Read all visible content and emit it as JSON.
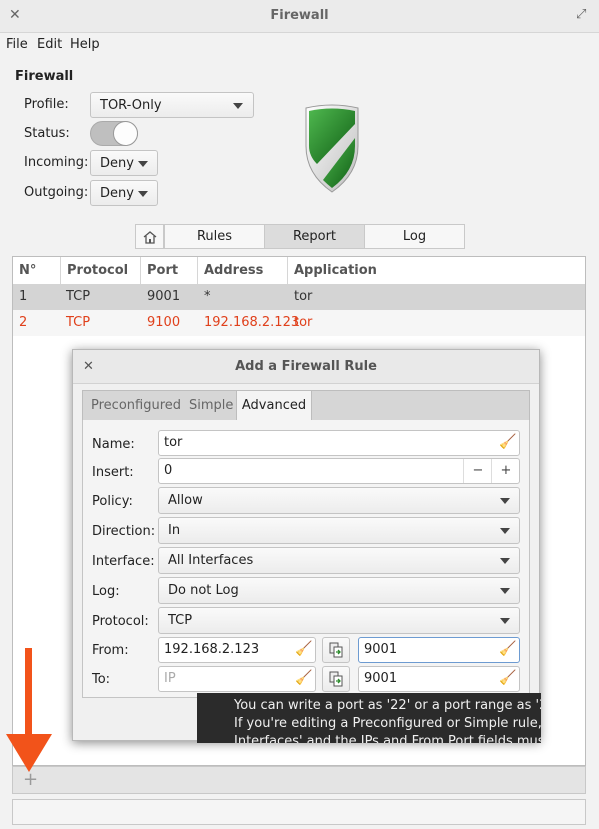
{
  "window": {
    "title": "Firewall"
  },
  "menu": [
    "File",
    "Edit",
    "Help"
  ],
  "firewall": {
    "section_title": "Firewall",
    "profile_label": "Profile:",
    "profile_value": "TOR-Only",
    "status_label": "Status:",
    "status_on": true,
    "incoming_label": "Incoming:",
    "incoming_value": "Deny",
    "outgoing_label": "Outgoing:",
    "outgoing_value": "Deny"
  },
  "view_tabs": {
    "rules": "Rules",
    "report": "Report",
    "log": "Log"
  },
  "table": {
    "headers": [
      "N°",
      "Protocol",
      "Port",
      "Address",
      "Application"
    ],
    "rows": [
      [
        "1",
        "TCP",
        "9001",
        "*",
        "tor"
      ],
      [
        "2",
        "TCP",
        "9100",
        "192.168.2.123",
        "tor"
      ]
    ]
  },
  "bottom": {
    "add_label": "+"
  },
  "dialog": {
    "title": "Add a Firewall Rule",
    "tabs": [
      "Preconfigured",
      "Simple",
      "Advanced"
    ],
    "name_label": "Name:",
    "name_value": "tor",
    "insert_label": "Insert:",
    "insert_value": "0",
    "policy_label": "Policy:",
    "policy_value": "Allow",
    "direction_label": "Direction:",
    "direction_value": "In",
    "interface_label": "Interface:",
    "interface_value": "All Interfaces",
    "log_label": "Log:",
    "log_value": "Do not Log",
    "protocol_label": "Protocol:",
    "protocol_value": "TCP",
    "from_label": "From:",
    "from_ip": "192.168.2.123",
    "from_port": "9001",
    "to_label": "To:",
    "to_ip_placeholder": "IP",
    "to_port": "9001"
  },
  "tooltip": {
    "line1": "You can write a port as '22' or a port range as '22:24'.",
    "line2": "If you're editing a Preconfigured or Simple rule, Interface",
    "line3": "Interfaces' and the IPs and From Port fields must be em"
  },
  "colors": {
    "highlight_row": "#d4d4d4",
    "red_text": "#e0401b",
    "arrow": "#f2531a",
    "shield_green": "#2a8a2a"
  }
}
